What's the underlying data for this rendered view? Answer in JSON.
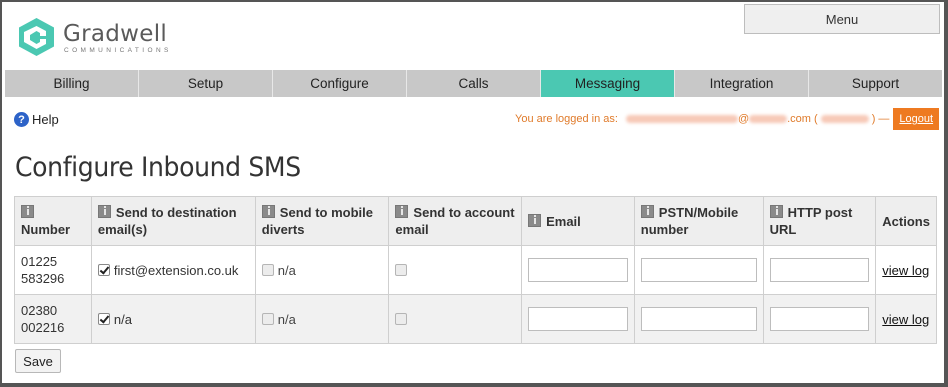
{
  "brand": {
    "name": "Gradwell",
    "tagline": "COMMUNICATIONS",
    "accent": "#4bc8b2"
  },
  "header": {
    "menu_label": "Menu"
  },
  "nav": {
    "items": [
      "Billing",
      "Setup",
      "Configure",
      "Calls",
      "Messaging",
      "Integration",
      "Support"
    ],
    "active": "Messaging"
  },
  "help_label": "Help",
  "login": {
    "prefix": "You are logged in as:",
    "at": "@",
    "domain_suffix": ".com (",
    "close": ") —",
    "logout_label": "Logout"
  },
  "page_title": "Configure Inbound SMS",
  "table": {
    "headers": {
      "number": "Number",
      "send_dest": "Send to destination email(s)",
      "send_mobile": "Send to mobile diverts",
      "send_account": "Send to account email",
      "email": "Email",
      "pstn": "PSTN/Mobile number",
      "http": "HTTP post URL",
      "actions": "Actions"
    },
    "rows": [
      {
        "number_line1": "01225",
        "number_line2": "583296",
        "dest_text": "first@extension.co.uk",
        "dest_checked": true,
        "mobile_text": "n/a",
        "action": "view log"
      },
      {
        "number_line1": "02380",
        "number_line2": "002216",
        "dest_text": "n/a",
        "dest_checked": true,
        "mobile_text": "n/a",
        "action": "view log"
      }
    ]
  },
  "save_label": "Save"
}
